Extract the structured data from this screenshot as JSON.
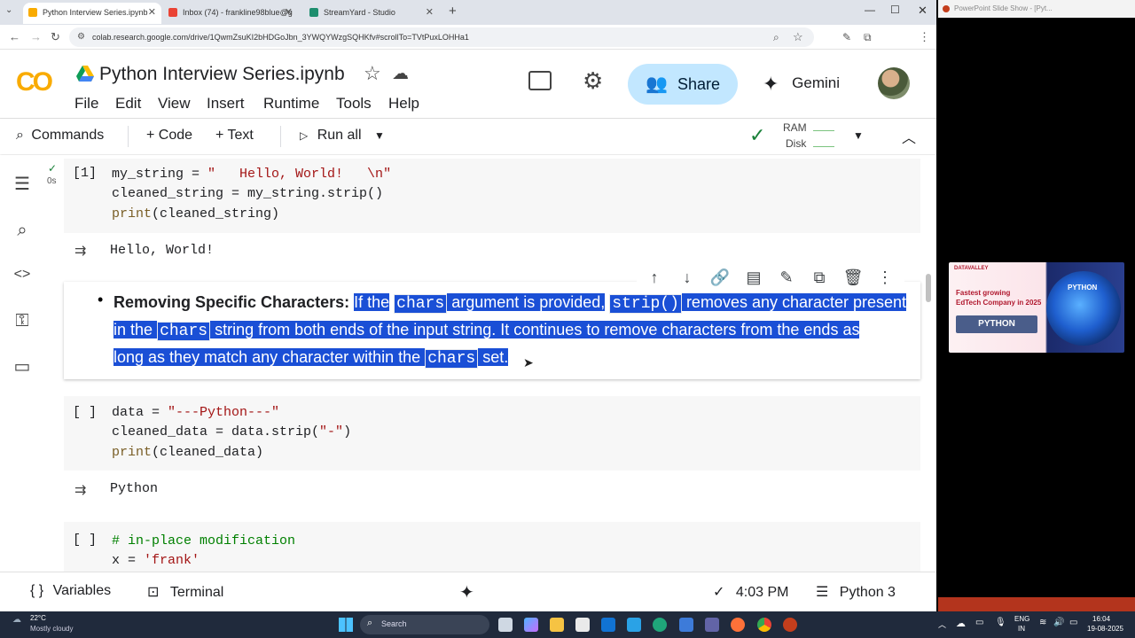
{
  "browser": {
    "tabs": [
      {
        "label": "Python Interview Series.ipynb",
        "active": true
      },
      {
        "label": "Inbox (74) - frankline98blue@g",
        "active": false
      },
      {
        "label": "StreamYard - Studio",
        "active": false
      }
    ],
    "url": "colab.research.google.com/drive/1QwmZsuKI2bHDGoJbn_3YWQYWzgSQHKfv#scrollTo=TVtPuxLOHHa1"
  },
  "colab": {
    "logo": "CO",
    "title": "Python Interview Series.ipynb",
    "menu": [
      "File",
      "Edit",
      "View",
      "Insert",
      "Runtime",
      "Tools",
      "Help"
    ],
    "share_label": "Share",
    "gemini_label": "Gemini"
  },
  "toolbar": {
    "commands": "Commands",
    "code": "+ Code",
    "text": "+ Text",
    "run_all": "Run all",
    "ram": "RAM",
    "disk": "Disk"
  },
  "cells": {
    "cell1": {
      "exec_num": "[1]",
      "time": "0s",
      "lines": [
        {
          "a": "my_string = ",
          "s": "\"   Hello, World!   \\n\""
        },
        {
          "a": "cleaned_string = my_string.strip()"
        },
        {
          "f": "print",
          "a": "(cleaned_string)"
        }
      ],
      "output": "Hello, World!"
    },
    "text": {
      "bold": "Removing Specific Characters:",
      "line1": [
        "If the",
        "chars",
        "argument is provided,",
        "strip()",
        "removes any character present"
      ],
      "line2": [
        "in the",
        "chars",
        "string from both ends of the input string. It continues to remove characters from the ends as"
      ],
      "line3": [
        "long as they match any character within the",
        "chars",
        "set."
      ]
    },
    "cell2": {
      "exec_num": "[ ]",
      "lines": [
        {
          "a": "data = ",
          "s": "\"---Python---\""
        },
        {
          "a": "cleaned_data = data.strip(",
          "s": "\"-\"",
          "b": ")"
        },
        {
          "f": "print",
          "a": "(cleaned_data)"
        }
      ],
      "output": "Python"
    },
    "cell3": {
      "exec_num": "[ ]",
      "lines": [
        {
          "c": "# in-place modification"
        },
        {
          "a": "x = ",
          "s": "'frank'"
        }
      ]
    }
  },
  "statusbar": {
    "variables": "Variables",
    "terminal": "Terminal",
    "time": "4:03 PM",
    "kernel": "Python 3"
  },
  "right_window": {
    "title": "PowerPoint Slide Show - [Pyt...",
    "ad": {
      "brand": "DATAVALLEY",
      "line1": "Fastest growing",
      "line2": "EdTech Company in 2025",
      "button": "PYTHON",
      "badge": "PYTHON"
    }
  },
  "taskbar": {
    "weather_temp": "22°C",
    "weather_desc": "Mostly cloudy",
    "search": "Search",
    "lang1": "ENG",
    "lang2": "IN",
    "clock_time": "16:04",
    "clock_date": "19-08-2025"
  }
}
